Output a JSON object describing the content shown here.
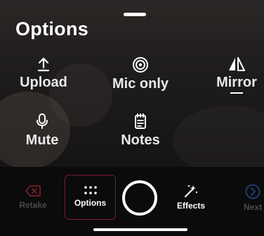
{
  "sheet": {
    "title": "Options",
    "options": [
      {
        "label": "Upload",
        "icon": "upload-icon"
      },
      {
        "label": "Mic only",
        "icon": "mic-only-icon"
      },
      {
        "label": "Mirror",
        "icon": "mirror-icon"
      },
      {
        "label": "Mute",
        "icon": "mic-icon"
      },
      {
        "label": "Notes",
        "icon": "notes-icon"
      }
    ]
  },
  "toolbar": {
    "retake_label": "Retake",
    "options_label": "Options",
    "effects_label": "Effects",
    "next_label": "Next"
  },
  "colors": {
    "accent_border": "#7a1c2b",
    "disabled_text": "#4a4a4a",
    "retake_icon": "#6b1e25",
    "next_icon": "#1f3d7a"
  }
}
